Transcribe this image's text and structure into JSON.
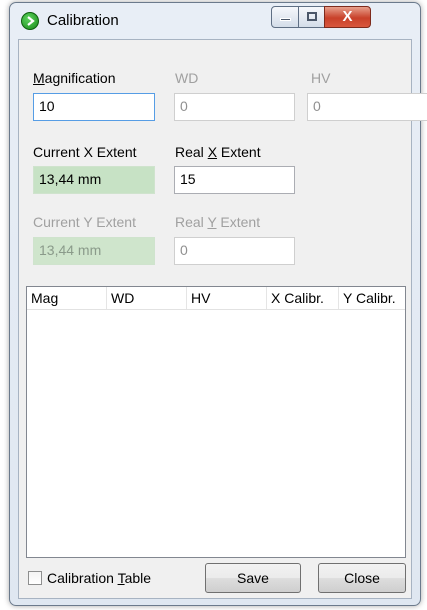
{
  "window": {
    "title": "Calibration",
    "controls": {
      "minimize": "minimize",
      "maximize": "maximize",
      "close": "X"
    }
  },
  "fields": {
    "magnification": {
      "label_u": "M",
      "label_rest": "agnification",
      "value": "10"
    },
    "wd": {
      "label": "WD",
      "value": "0"
    },
    "hv": {
      "label": "HV",
      "value": "0"
    },
    "current_x": {
      "label": "Current X Extent",
      "value": "13,44 mm"
    },
    "real_x": {
      "label_pre": "Real ",
      "label_u": "X",
      "label_post": " Extent",
      "value": "15"
    },
    "current_y": {
      "label": "Current Y Extent",
      "value": "13,44 mm"
    },
    "real_y": {
      "label_pre": "Real ",
      "label_u": "Y",
      "label_post": " Extent",
      "value": "0"
    }
  },
  "table": {
    "columns": [
      "Mag",
      "WD",
      "HV",
      "X Calibr.",
      "Y Calibr."
    ],
    "rows": []
  },
  "footer": {
    "checkbox_pre": "Calibration ",
    "checkbox_u": "T",
    "checkbox_post": "able",
    "checkbox_checked": false,
    "save_label": "Save",
    "close_label": "Close"
  },
  "colors": {
    "extent_readout_bg": "#c7e2c5",
    "focus_border": "#569de5"
  }
}
